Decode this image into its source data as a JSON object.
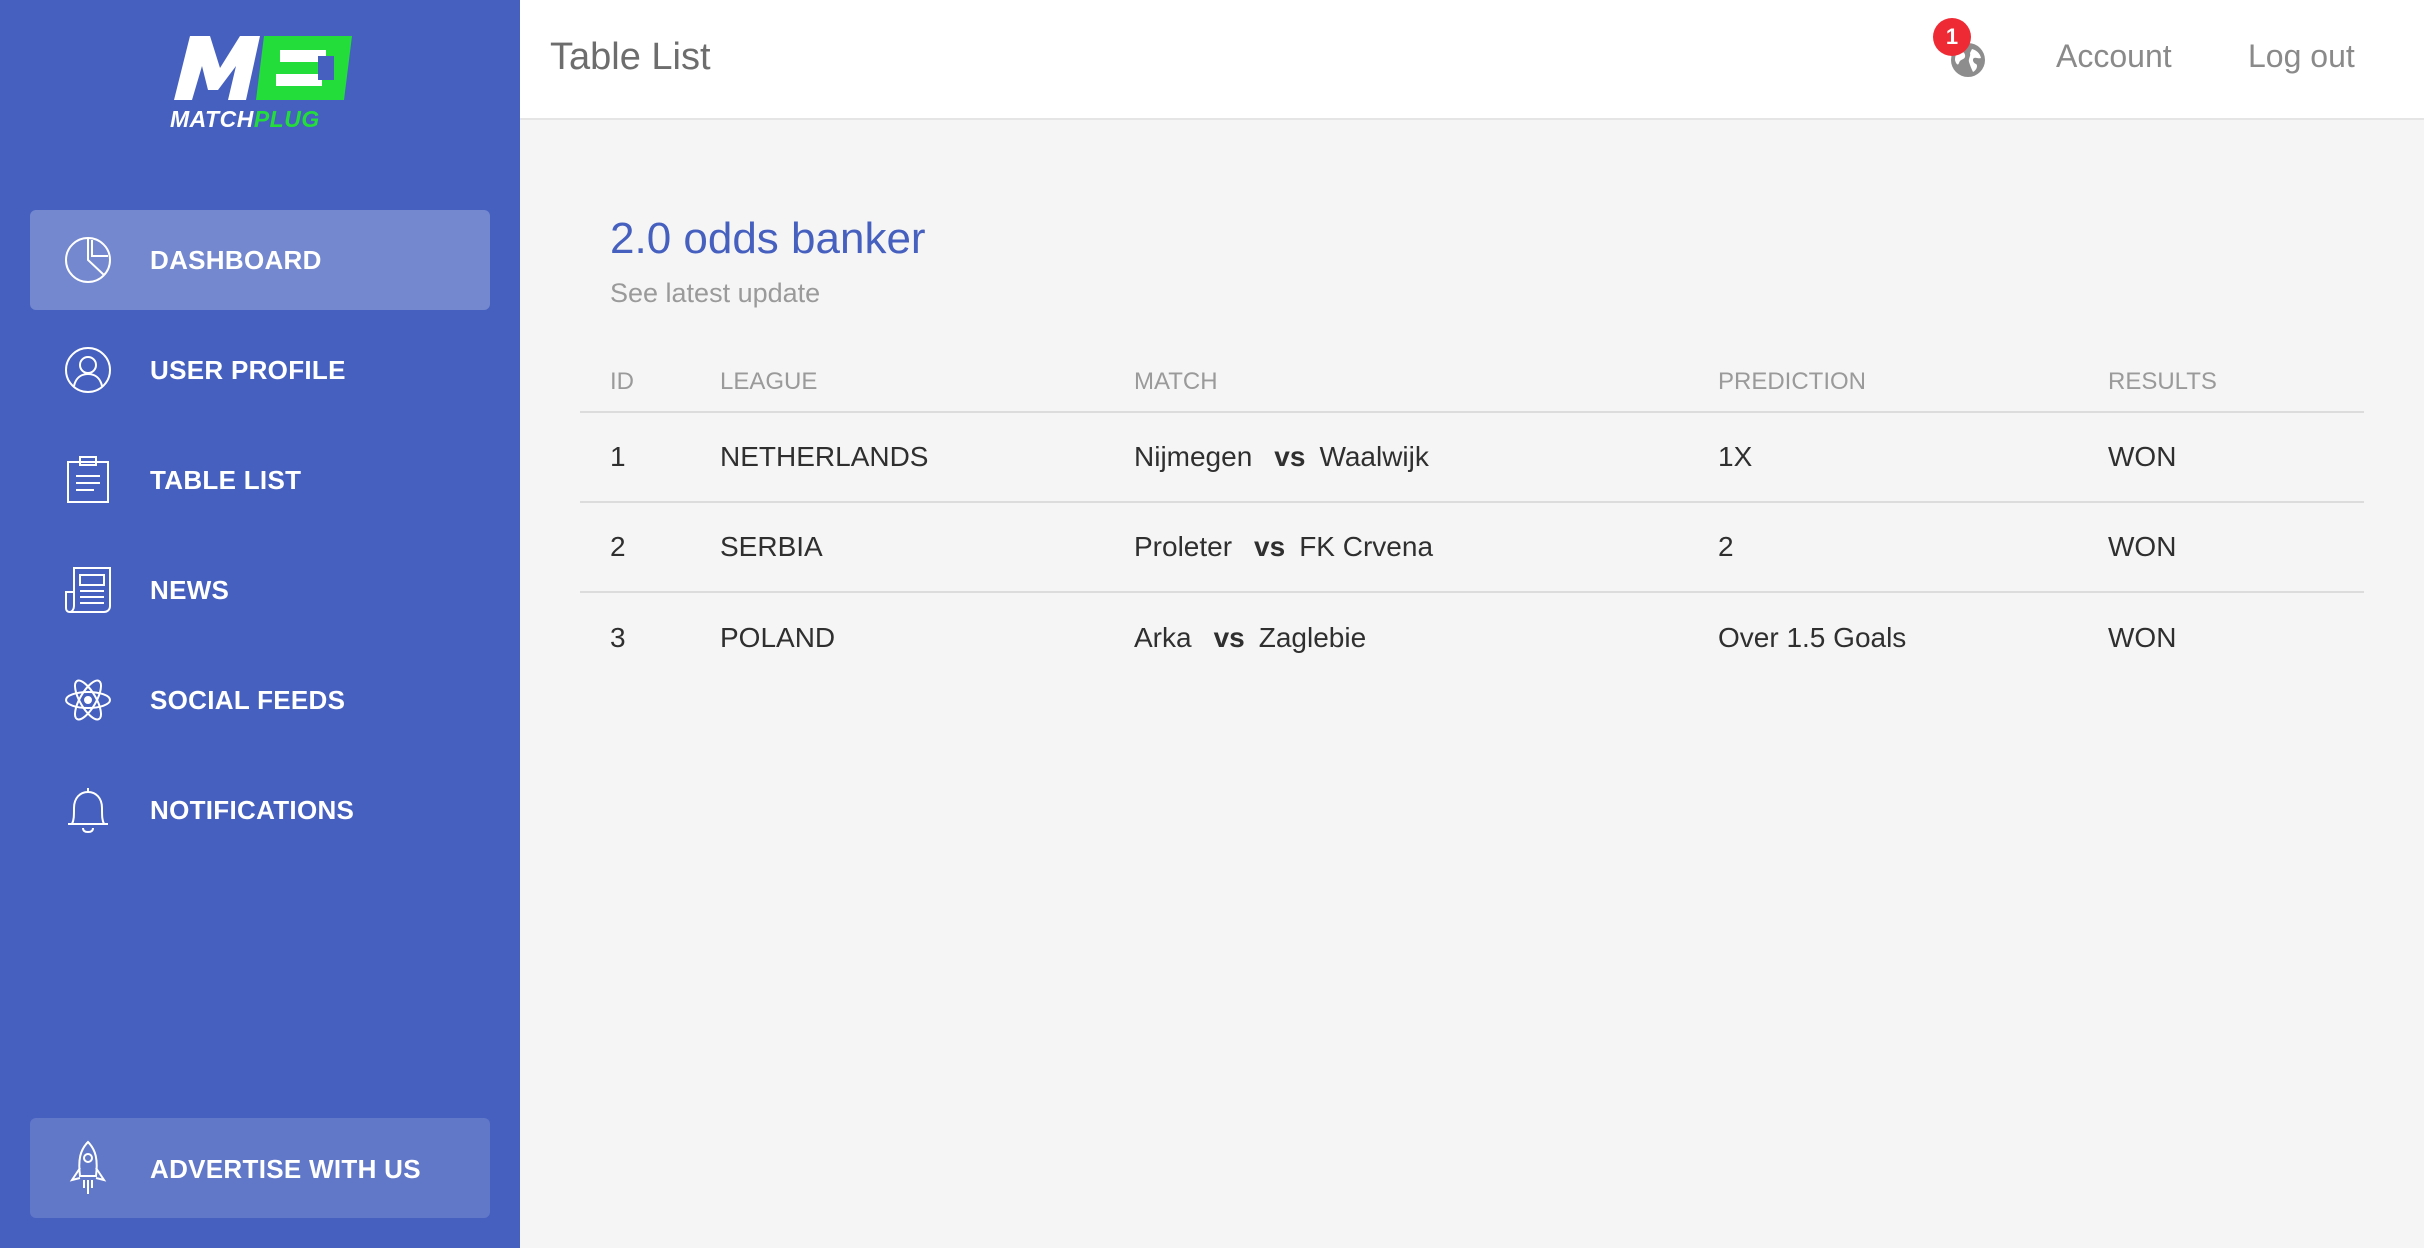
{
  "brand": {
    "logo_text_white": "MATCH",
    "logo_text_green": "PLUG",
    "colors": {
      "primary": "#4660bf",
      "accent_green": "#22dd3a",
      "badge_red": "#ee2b35"
    }
  },
  "sidebar": {
    "items": [
      {
        "label": "DASHBOARD",
        "icon": "pie-chart-icon",
        "active": true
      },
      {
        "label": "USER PROFILE",
        "icon": "user-circle-icon",
        "active": false
      },
      {
        "label": "TABLE LIST",
        "icon": "clipboard-icon",
        "active": false
      },
      {
        "label": "NEWS",
        "icon": "newspaper-icon",
        "active": false
      },
      {
        "label": "SOCIAL FEEDS",
        "icon": "atom-icon",
        "active": false
      },
      {
        "label": "NOTIFICATIONS",
        "icon": "bell-icon",
        "active": false
      }
    ],
    "advertise": {
      "label": "ADVERTISE WITH US",
      "icon": "rocket-icon"
    }
  },
  "header": {
    "title": "Table List",
    "notification_count": "1",
    "globe_icon": "globe-icon",
    "account_label": "Account",
    "logout_label": "Log out"
  },
  "card": {
    "title": "2.0 odds banker",
    "subtitle": "See latest update"
  },
  "table": {
    "columns": [
      "ID",
      "LEAGUE",
      "MATCH",
      "PREDICTION",
      "RESULTS"
    ],
    "rows": [
      {
        "id": "1",
        "league": "NETHERLANDS",
        "home": "Nijmegen",
        "vs": "vs",
        "away": "Waalwijk",
        "prediction": "1X",
        "result": "WON"
      },
      {
        "id": "2",
        "league": "SERBIA",
        "home": "Proleter",
        "vs": "vs",
        "away": "FK Crvena",
        "prediction": "2",
        "result": "WON"
      },
      {
        "id": "3",
        "league": "POLAND",
        "home": "Arka",
        "vs": "vs",
        "away": "Zaglebie",
        "prediction": "Over 1.5 Goals",
        "result": "WON"
      }
    ]
  }
}
